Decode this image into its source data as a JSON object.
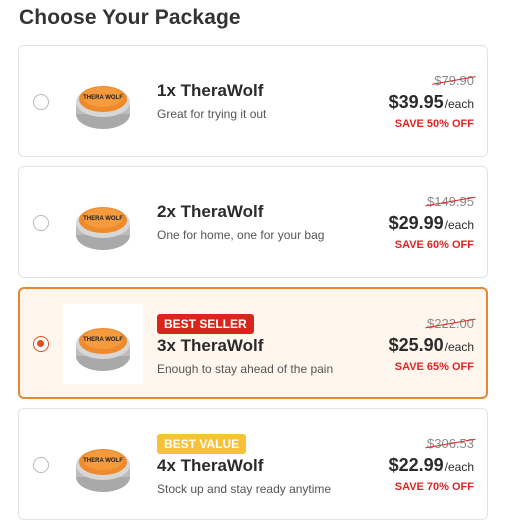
{
  "page": {
    "title": "Choose Your Package"
  },
  "colors": {
    "accent": "#e8872f",
    "sale_red": "#e02424",
    "badge_best_seller": "#d9261c",
    "badge_best_value": "#f6c23a",
    "strike": "#d92a2a"
  },
  "packages": [
    {
      "name": "1x TheraWolf",
      "description": "Great for trying it out",
      "old_price": "$79.90",
      "price": "$39.95",
      "per": "/each",
      "save": "SAVE 50% OFF",
      "badge": "",
      "selected": false
    },
    {
      "name": "2x TheraWolf",
      "description": "One for home, one for your bag",
      "old_price": "$149.95",
      "price": "$29.99",
      "per": "/each",
      "save": "SAVE 60% OFF",
      "badge": "",
      "selected": false
    },
    {
      "name": "3x TheraWolf",
      "description": "Enough to stay ahead of the pain",
      "old_price": "$222.00",
      "price": "$25.90",
      "per": "/each",
      "save": "SAVE 65% OFF",
      "badge": "BEST SELLER",
      "selected": true
    },
    {
      "name": "4x TheraWolf",
      "description": "Stock up and stay ready anytime",
      "old_price": "$306.53",
      "price": "$22.99",
      "per": "/each",
      "save": "SAVE 70% OFF",
      "badge": "BEST VALUE",
      "selected": false
    }
  ],
  "product_image": {
    "label": "THERA WOLF",
    "icon": "balm-tin-icon"
  }
}
